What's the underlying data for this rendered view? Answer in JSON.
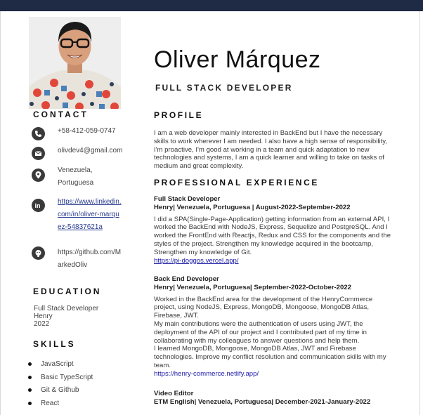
{
  "name": "Oliver Márquez",
  "job_title": "FULL STACK DEVELOPER",
  "headings": {
    "contact": "CONTACT",
    "education": "EDUCATION",
    "skills": "SKILLS",
    "profile": "PROFILE",
    "experience": "PROFESSIONAL EXPERIENCE"
  },
  "contact": {
    "phone": "+58-412-059-0747",
    "email": "olivdev4@gmail.com",
    "location_line1": "Venezuela,",
    "location_line2": "Portuguesa",
    "linkedin_line1": "https://www.linkedin.",
    "linkedin_line2": "com/in/oliver-marqu",
    "linkedin_line3": "ez-54837621a",
    "github_line1": "https://github.com/M",
    "github_line2": "arkedOliv"
  },
  "education": {
    "degree": "Full Stack Developer",
    "school": "Henry",
    "year": "2022"
  },
  "skills": [
    "JavaScript",
    "Basic TypeScript",
    "Git & Github",
    "React"
  ],
  "profile": "I am a web developer mainly interested in BackEnd but I have the necessary skills to work wherever I am needed. I also have a high sense of responsibility, I'm proactive, I'm good at working in a team and quick adaptation to new technologies and systems, I am a quick learner and willing to take on tasks of medium and great complexity.",
  "experience": [
    {
      "role": "Full Stack Developer",
      "company": "Henry| Venezuela, Portuguesa | August-2022-September-2022",
      "description": "I did a SPA(Single-Page-Application) getting information from an external API, I worked the BackEnd with NodeJS, Express, Sequelize and PostgreSQL. And I worked the FrontEnd with Reactjs, Redux and CSS for the components and the styles of the project. Strengthen my knowledge acquired in the bootcamp, Strengthen my knowledge of Git.",
      "link": "https://pi-doggos.vercel.app/"
    },
    {
      "role": "Back End Developer",
      "company": "Henry| Venezuela, Portuguesa| September-2022-October-2022",
      "description": "Worked in the BackEnd area for the development of the HenryCommerce project, using NodeJS, Express, MongoDB, Mongoose, MongoDB Atlas, Firebase, JWT.",
      "description2": "My main contributions were the authentication of users using JWT, the deployment of the API of our project and I contributed part of my time in collaborating with my colleagues to answer questions and help them.",
      "description3": "I learned MongoDB, Mongoose, MongoDB Atlas, JWT and Firebase technologies. Improve my conflict resolution and communication skills with my team.",
      "link": "https://henry-commerce.netlify.app/"
    },
    {
      "role": "Video Editor",
      "company": "ETM English| Venezuela, Portuguesa| December-2021-January-2022"
    }
  ]
}
